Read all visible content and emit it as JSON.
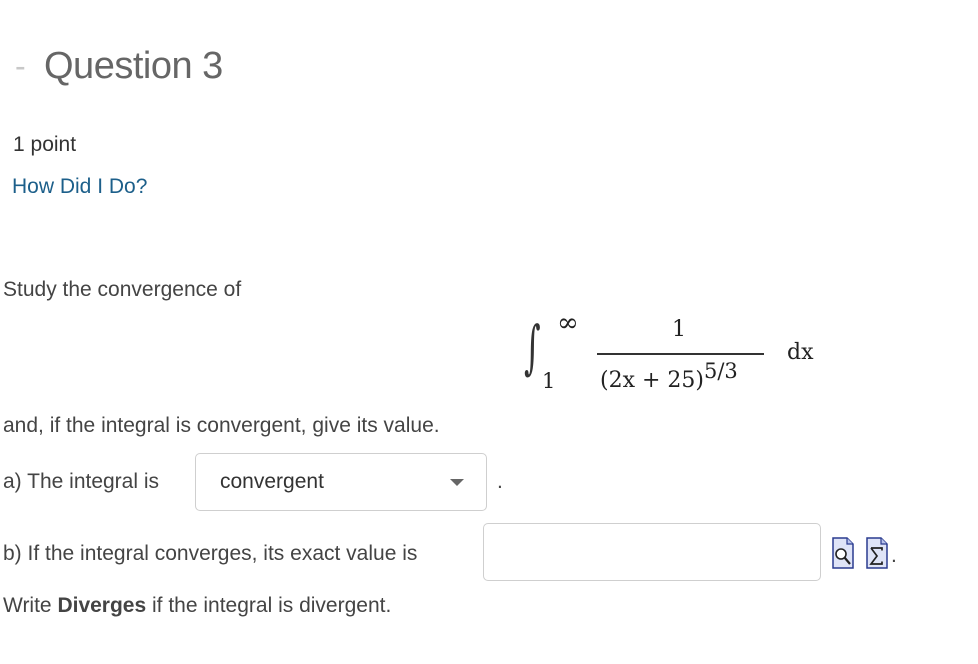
{
  "question": {
    "collapse_symbol": "-",
    "title": "Question 3",
    "points": "1 point",
    "help_link": "How Did I Do?"
  },
  "problem": {
    "prompt": "Study the convergence of",
    "integral": {
      "sign": "∫",
      "upper_limit": "∞",
      "lower_limit": "1",
      "numerator": "1",
      "denominator_base": "(2x + 25)",
      "denominator_exponent": "5/3",
      "differential": "dx"
    },
    "instruction": "and, if the integral is convergent, give its value."
  },
  "part_a": {
    "label": "a) The integral is",
    "selected_option": "convergent",
    "trailing": "."
  },
  "part_b": {
    "label": "b) If the integral converges, its exact value is",
    "input_value": "",
    "icons": [
      "preview-icon",
      "equation-editor-icon"
    ],
    "trailing": "."
  },
  "note": {
    "prefix": "Write ",
    "bold_word": "Diverges",
    "suffix": " if the integral is divergent."
  },
  "colors": {
    "link": "#1c5f8a",
    "title": "#666666",
    "text": "#444444",
    "border": "#cfcfcf"
  }
}
